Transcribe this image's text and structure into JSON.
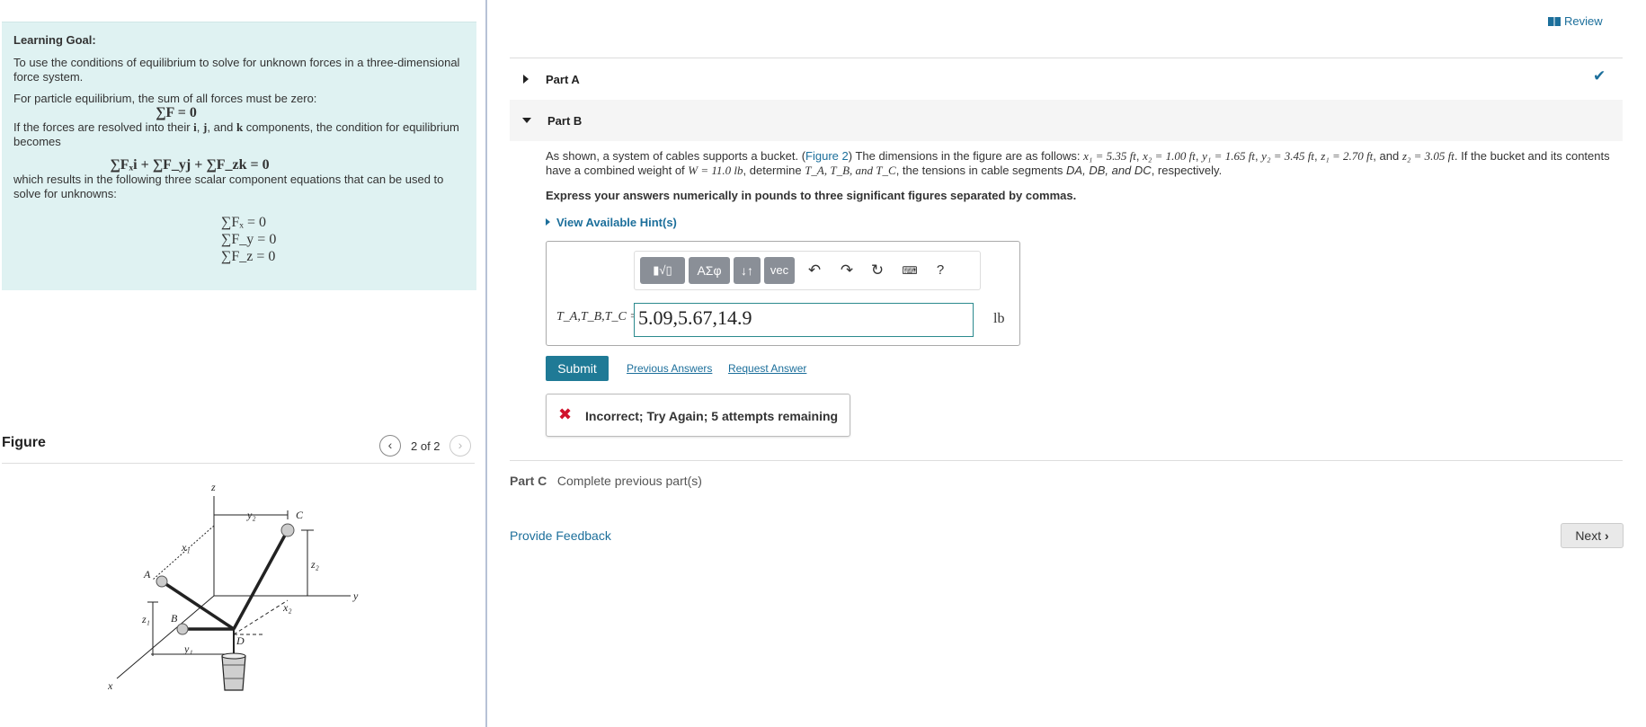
{
  "left": {
    "learning_goal_title": "Learning Goal:",
    "learning_goal_text": "To use the conditions of equilibrium to solve for unknown forces in a three-dimensional force system.",
    "para1": "For particle equilibrium, the sum of all forces must be zero:",
    "eq1": "∑F = 0",
    "para2_a": "If the forces are resolved into their",
    "para2_i": "i",
    "para2_comma": ",",
    "para2_j": "j",
    "para2_and": ", and",
    "para2_k": "k",
    "para2_b": "components, the condition for equilibrium becomes",
    "eq2": "∑Fₓi + ∑F_yj + ∑F_zk = 0",
    "para3": "which results in the following three scalar component equations that can be used to solve for unknowns:",
    "eq3": [
      "∑Fₓ = 0",
      "∑F_y = 0",
      "∑F_z = 0"
    ]
  },
  "figure": {
    "title": "Figure",
    "pager": "2 of 2",
    "labels": {
      "z": "z",
      "y": "y",
      "x": "x",
      "y2": "y₂",
      "C": "C",
      "x1": "x₁",
      "z2": "z₂",
      "A": "A",
      "B": "B",
      "z1": "z₁",
      "x2": "x₂",
      "D": "D",
      "y1": "y₁"
    }
  },
  "right": {
    "review": "Review",
    "part_a": "Part A",
    "part_b": "Part B",
    "problem": {
      "t1": "As shown, a system of cables supports a bucket. (",
      "figure_link": "Figure 2",
      "t2": ") The dimensions in the figure are as follows: ",
      "x1": "x₁ = 5.35 ft",
      "x2": "x₂ = 1.00 ft",
      "y1": "y₁ = 1.65 ft",
      "y2": "y₂ = 3.45 ft",
      "z1": "z₁ = 2.70 ft",
      "and": ", and ",
      "z2": "z₂ = 3.05 ft",
      "t3": ". If the bucket and its contents have a combined weight of ",
      "W": "W = 11.0 lb",
      "t4": ", determine ",
      "T": "T_A, T_B, and T_C",
      "t5": ", the tensions in cable segments ",
      "segs": "DA, DB, and DC",
      "t6": ", respectively."
    },
    "express": "Express your answers numerically in pounds to three significant figures separated by commas.",
    "hints": "View Available Hint(s)",
    "toolbar": {
      "templates": "▮√▯",
      "greek": "ΑΣφ",
      "arrows": "↓↑",
      "vec": "vec",
      "help": "?"
    },
    "answer_label": "T_A,T_B,T_C =",
    "answer_value": "5.09,5.67,14.9",
    "unit": "lb",
    "submit": "Submit",
    "previous_answers": "Previous Answers",
    "request_answer": "Request Answer",
    "feedback": "Incorrect; Try Again; 5 attempts remaining",
    "part_c": "Part C",
    "part_c_status": "Complete previous part(s)",
    "provide_feedback": "Provide Feedback",
    "next": "Next"
  },
  "colors": {
    "goal_bg": "#dff2f2",
    "link": "#1c6f9b",
    "submit_bg": "#1f7a96",
    "error": "#d0122b",
    "check": "#1c6f9b"
  }
}
